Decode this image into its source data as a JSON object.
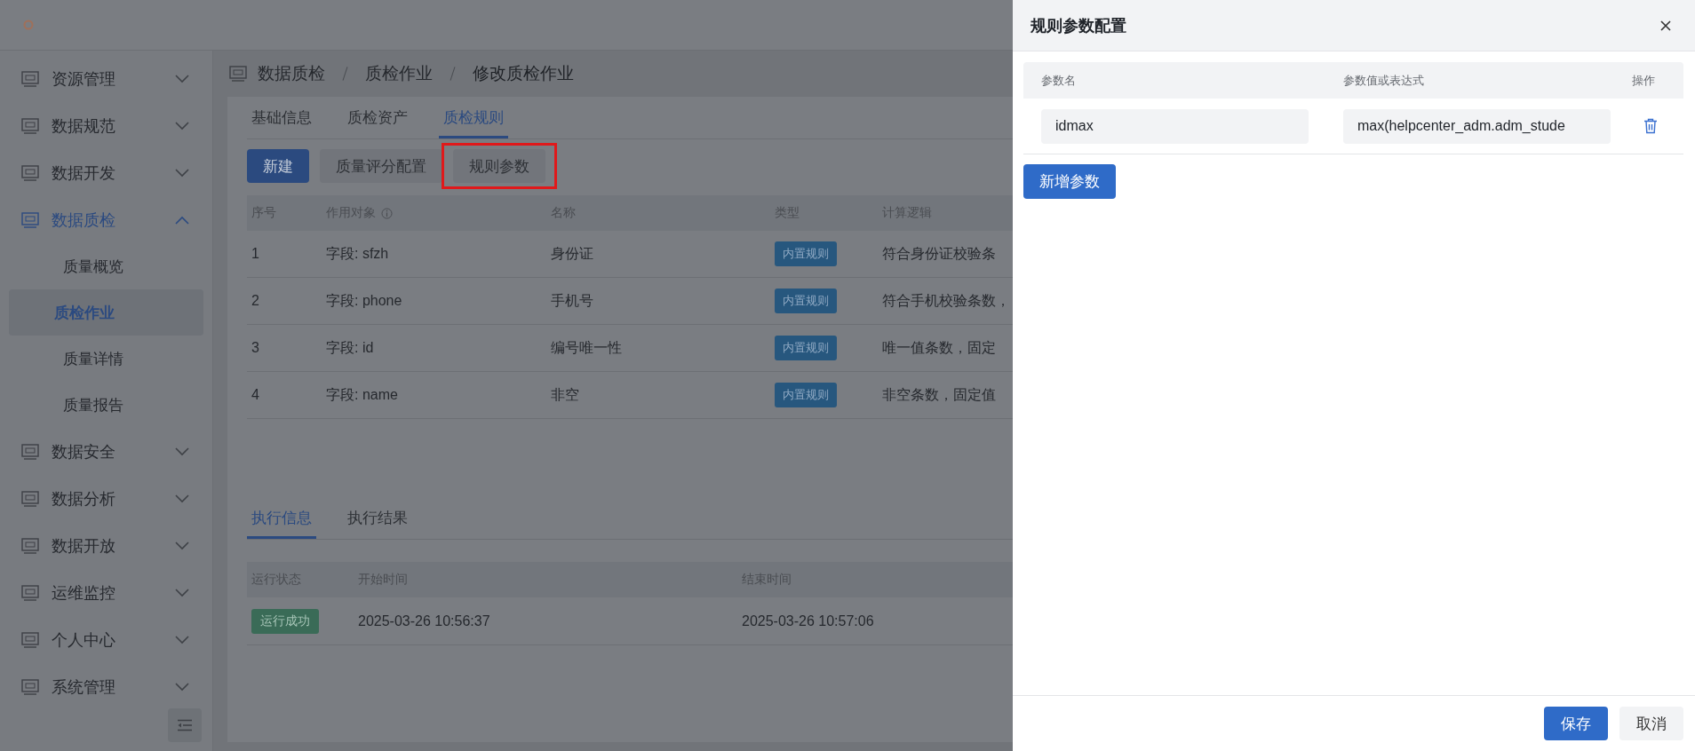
{
  "sidebar": {
    "items": [
      {
        "label": "资源管理",
        "selected": false,
        "expanded": false
      },
      {
        "label": "数据规范",
        "selected": false,
        "expanded": false
      },
      {
        "label": "数据开发",
        "selected": false,
        "expanded": false
      },
      {
        "label": "数据质检",
        "selected": true,
        "expanded": true,
        "children": [
          {
            "label": "质量概览",
            "selected": false
          },
          {
            "label": "质检作业",
            "selected": true
          },
          {
            "label": "质量详情",
            "selected": false
          },
          {
            "label": "质量报告",
            "selected": false
          }
        ]
      },
      {
        "label": "数据安全",
        "selected": false,
        "expanded": false
      },
      {
        "label": "数据分析",
        "selected": false,
        "expanded": false
      },
      {
        "label": "数据开放",
        "selected": false,
        "expanded": false
      },
      {
        "label": "运维监控",
        "selected": false,
        "expanded": false
      },
      {
        "label": "个人中心",
        "selected": false,
        "expanded": false
      },
      {
        "label": "系统管理",
        "selected": false,
        "expanded": false
      }
    ]
  },
  "breadcrumb": [
    "数据质检",
    "质检作业",
    "修改质检作业"
  ],
  "tabs": [
    {
      "label": "基础信息",
      "selected": false
    },
    {
      "label": "质检资产",
      "selected": false
    },
    {
      "label": "质检规则",
      "selected": true
    }
  ],
  "toolbar": [
    {
      "label": "新建",
      "kind": "primary",
      "highlighted": false
    },
    {
      "label": "质量评分配置",
      "kind": "default",
      "highlighted": false
    },
    {
      "label": "规则参数",
      "kind": "default",
      "highlighted": true
    }
  ],
  "rules_table": {
    "columns": [
      "序号",
      "作用对象",
      "名称",
      "类型",
      "计算逻辑"
    ],
    "rows": [
      {
        "index": "1",
        "target": "字段: sfzh",
        "name": "身份证",
        "type": "内置规则",
        "logic": "符合身份证校验条"
      },
      {
        "index": "2",
        "target": "字段: phone",
        "name": "手机号",
        "type": "内置规则",
        "logic": "符合手机校验条数，"
      },
      {
        "index": "3",
        "target": "字段: id",
        "name": "编号唯一性",
        "type": "内置规则",
        "logic": "唯一值条数，固定"
      },
      {
        "index": "4",
        "target": "字段: name",
        "name": "非空",
        "type": "内置规则",
        "logic": "非空条数，固定值"
      }
    ]
  },
  "execution": {
    "tabs": [
      {
        "label": "执行信息",
        "selected": true
      },
      {
        "label": "执行结果",
        "selected": false
      }
    ],
    "columns": [
      "运行状态",
      "开始时间",
      "结束时间"
    ],
    "rows": [
      {
        "status": "运行成功",
        "kind": "success",
        "start": "2025-03-26 10:56:37",
        "end": "2025-03-26 10:57:06"
      }
    ]
  },
  "drawer": {
    "title": "规则参数配置",
    "columns": [
      "参数名",
      "参数值或表达式",
      "操作"
    ],
    "params": [
      {
        "name": "idmax",
        "value": "max(helpcenter_adm.adm_stude"
      }
    ],
    "add_button": "新增参数",
    "footer_buttons": [
      {
        "label": "保存",
        "kind": "primary"
      },
      {
        "label": "取消",
        "kind": "default"
      }
    ]
  }
}
